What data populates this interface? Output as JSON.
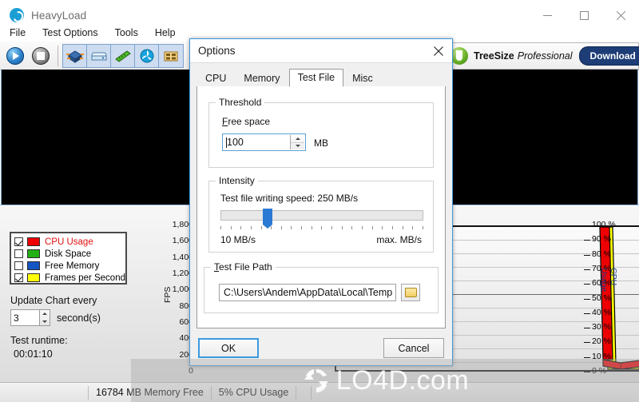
{
  "window": {
    "title": "HeavyLoad",
    "icon": "heavyload-icon",
    "controls": {
      "minimize": "minimize-icon",
      "maximize": "maximize-icon",
      "close": "close-icon"
    }
  },
  "menubar": {
    "items": [
      "File",
      "Test Options",
      "Tools",
      "Help"
    ]
  },
  "toolbar": {
    "buttons": [
      {
        "name": "start-test-button",
        "icon": "play-icon"
      },
      {
        "name": "stop-test-button",
        "icon": "stop-icon"
      }
    ],
    "test_group": [
      {
        "name": "test-cpu-button",
        "icon": "cpu-icon"
      },
      {
        "name": "test-disk-button",
        "icon": "disk-icon"
      },
      {
        "name": "test-memory-button",
        "icon": "memory-icon"
      },
      {
        "name": "test-gpu-button",
        "icon": "fan-icon"
      },
      {
        "name": "test-device-button",
        "icon": "board-icon"
      }
    ]
  },
  "banner": {
    "product": "TreeSize",
    "edition": "Professional",
    "download_label": "Download",
    "icon": "treesize-icon"
  },
  "legend": {
    "items": [
      {
        "label": "CPU Usage",
        "color": "#ee0000",
        "checked": true,
        "text_color": "#e21010"
      },
      {
        "label": "Disk Space",
        "color": "#22b014",
        "checked": false,
        "text_color": "#000000"
      },
      {
        "label": "Free Memory",
        "color": "#1455c4",
        "checked": false,
        "text_color": "#000000"
      },
      {
        "label": "Frames per Second",
        "color": "#ffff00",
        "checked": true,
        "text_color": "#000000"
      }
    ]
  },
  "controls": {
    "update_chart_label": "Update Chart every",
    "update_interval_value": "3",
    "update_interval_unit": "second(s)",
    "runtime_label": "Test runtime:",
    "runtime_value": "00:01:10"
  },
  "statusbar": {
    "memory_free": "16784 MB Memory Free",
    "cpu_usage": "5% CPU Usage"
  },
  "watermark": {
    "text": "LO4D",
    "suffix": ".com"
  },
  "dialog": {
    "title": "Options",
    "close_icon": "close-icon",
    "tabs": [
      {
        "label": "CPU",
        "active": false
      },
      {
        "label": "Memory",
        "active": false
      },
      {
        "label": "Test File",
        "active": true
      },
      {
        "label": "Misc",
        "active": false
      }
    ],
    "threshold": {
      "group_title": "Threshold",
      "free_space_label": "Free space",
      "free_space_value": "100",
      "unit": "MB"
    },
    "intensity": {
      "group_title": "Intensity",
      "speed_label": "Test file writing speed: 250 MB/s",
      "slider_min_label": "10 MB/s",
      "slider_max_label": "max. MB/s",
      "slider_percent": 15
    },
    "test_file_path": {
      "group_title": "Test File Path",
      "path_value": "C:\\Users\\Andem\\AppData\\Local\\Temp",
      "browse_icon": "folder-icon"
    },
    "buttons": {
      "ok": "OK",
      "cancel": "Cancel"
    }
  },
  "chart_data": {
    "type": "line",
    "title": "",
    "xlabel": "",
    "left_axis": {
      "label": "FPS",
      "ticks": [
        "1,800",
        "1,600",
        "1,400",
        "1,200",
        "1,000",
        "800",
        "600",
        "400",
        "200",
        "0"
      ],
      "ylim": [
        0,
        1800
      ]
    },
    "right_axis": {
      "label": "CPU Usage",
      "ticks": [
        "100 %",
        "90 %",
        "80 %",
        "70 %",
        "60 %",
        "50 %",
        "40 %",
        "30 %",
        "20 %",
        "10 %",
        "0 %"
      ],
      "ylim": [
        0,
        100
      ]
    },
    "series": [
      {
        "name": "CPU Usage",
        "color": "#ee0000",
        "axis": "right",
        "values": [
          100,
          100,
          2,
          4,
          3,
          2,
          9,
          6,
          2,
          10,
          2,
          10,
          1
        ]
      },
      {
        "name": "Frames per Second",
        "color": "#ffff00",
        "axis": "left",
        "values": [
          1800,
          1800,
          0,
          0,
          0,
          0,
          0,
          0,
          0,
          0,
          0,
          0,
          0
        ]
      }
    ],
    "grid": true,
    "legend_position": "left-panel"
  }
}
